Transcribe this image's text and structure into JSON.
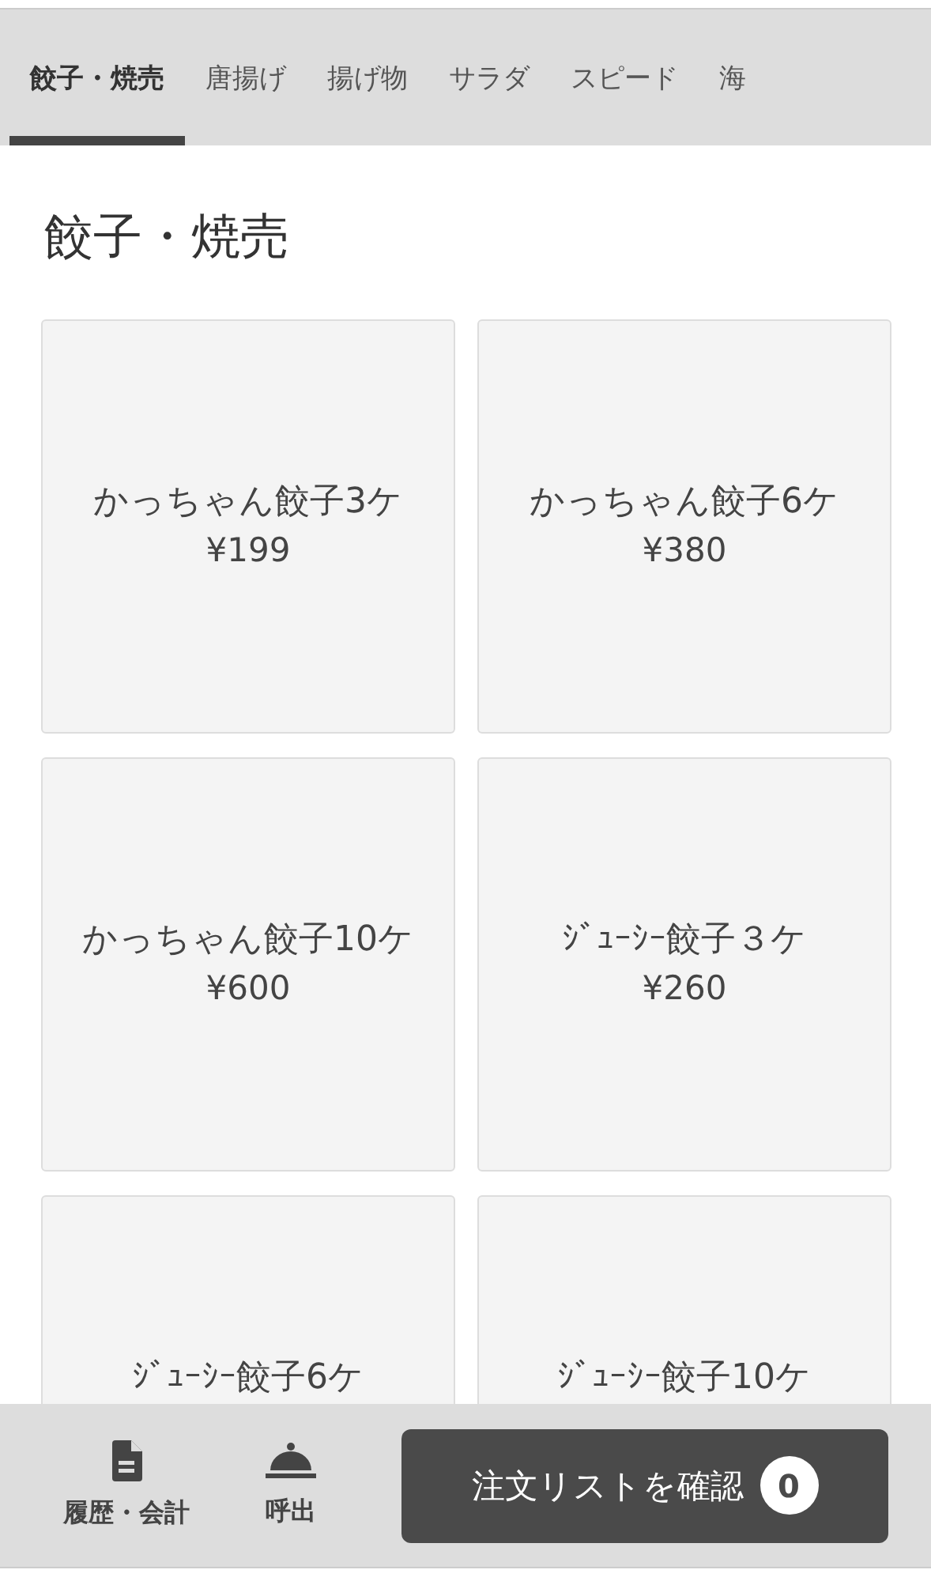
{
  "tabs": [
    {
      "label": "餃子・焼売",
      "selected": true
    },
    {
      "label": "唐揚げ",
      "selected": false
    },
    {
      "label": "揚げ物",
      "selected": false
    },
    {
      "label": "サラダ",
      "selected": false
    },
    {
      "label": "スピード",
      "selected": false
    },
    {
      "label": "海",
      "selected": false
    }
  ],
  "section_title": "餃子・焼売",
  "items": [
    {
      "name": "かっちゃん餃子3ケ",
      "price": "¥199"
    },
    {
      "name": "かっちゃん餃子6ケ",
      "price": "¥380"
    },
    {
      "name": "かっちゃん餃子10ケ",
      "price": "¥600"
    },
    {
      "name": "ｼﾞｭｰｼｰ餃子３ケ",
      "price": "¥260"
    },
    {
      "name": "ｼﾞｭｰｼｰ餃子6ケ"
    },
    {
      "name": "ｼﾞｭｰｼｰ餃子10ケ"
    }
  ],
  "bottom_bar": {
    "history_label": "履歴・会計",
    "call_label": "呼出",
    "order_button": "注文リストを確認",
    "order_count": "0"
  }
}
